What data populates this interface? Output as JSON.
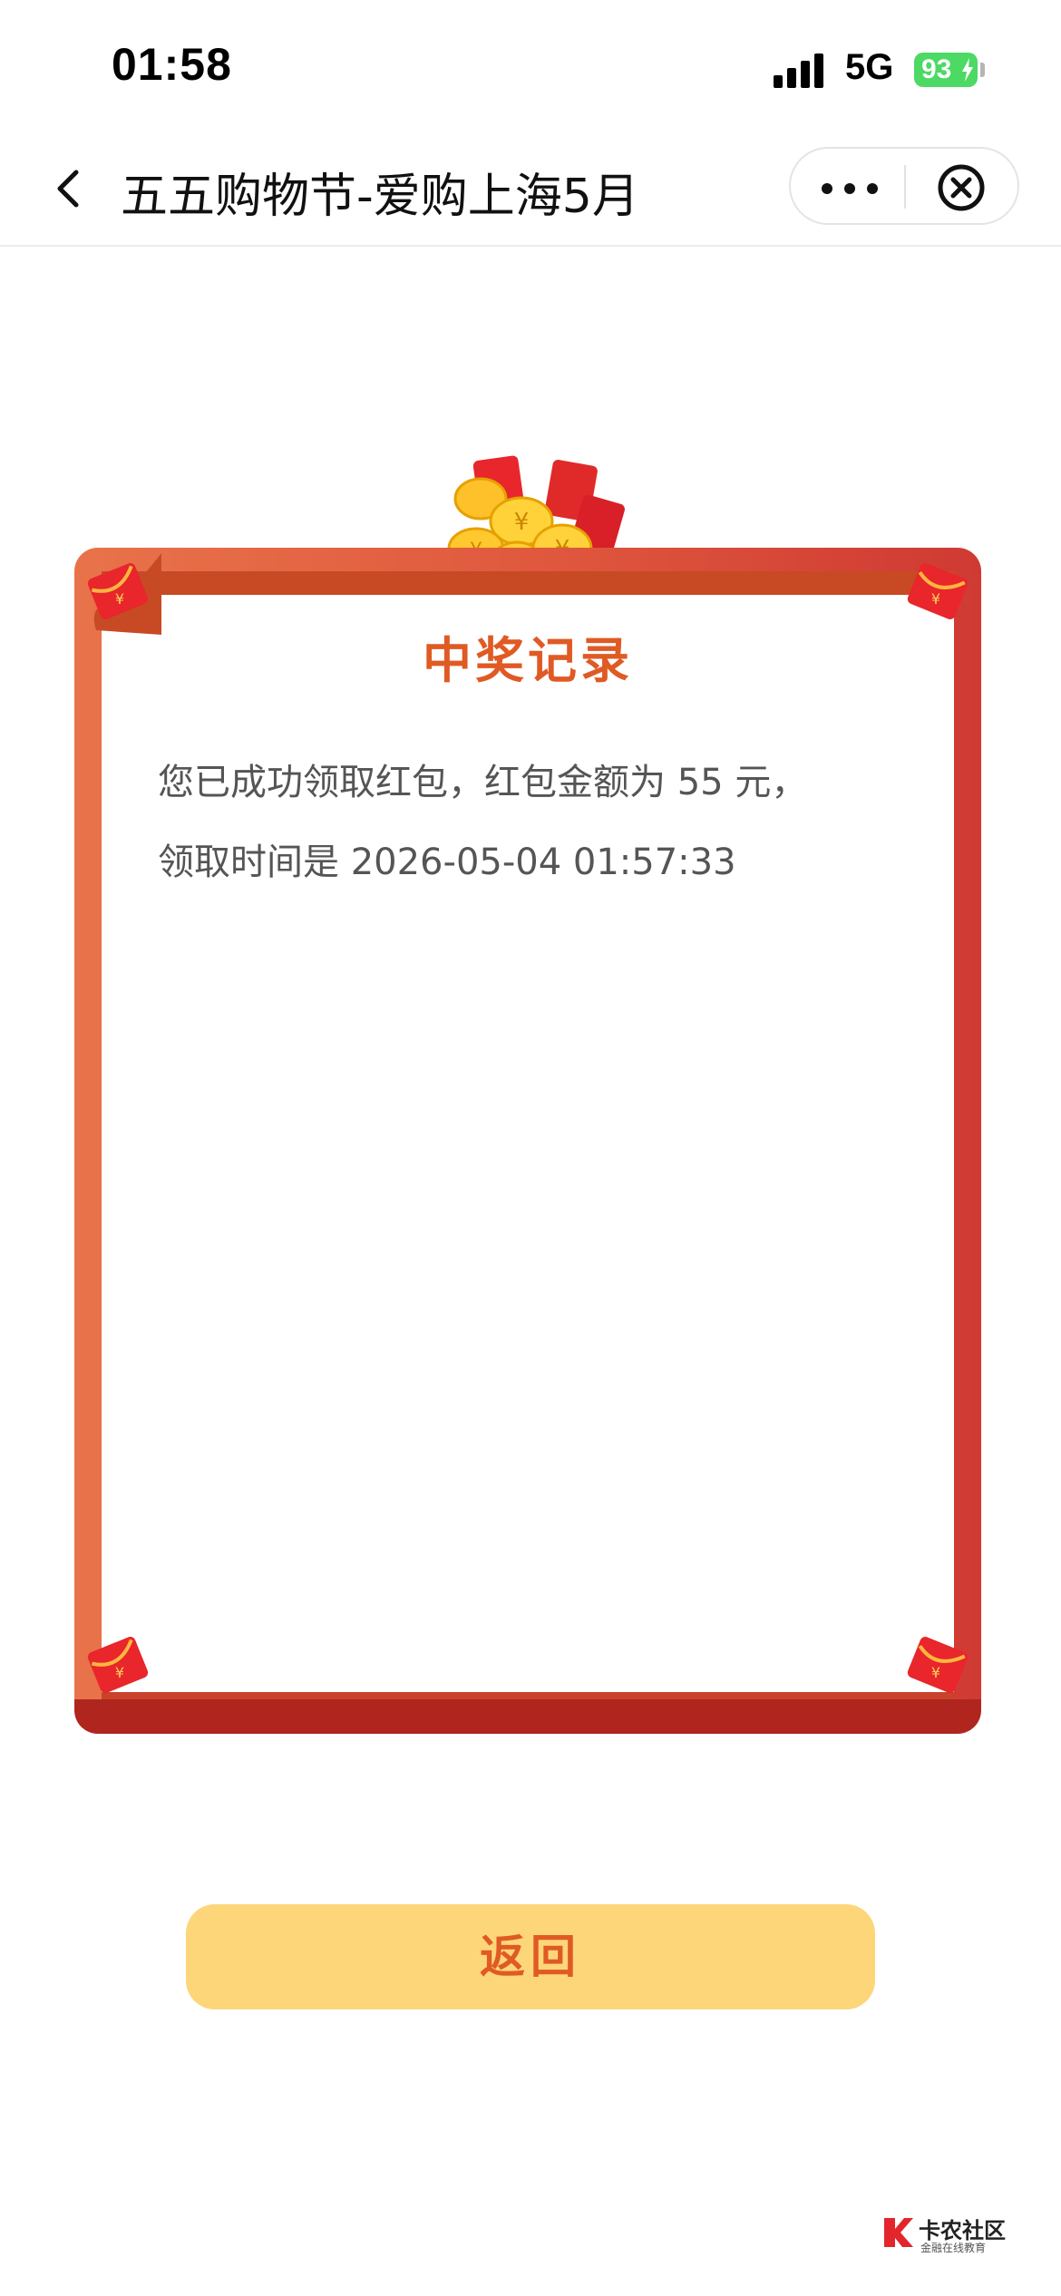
{
  "status_bar": {
    "time": "01:58",
    "network": "5G",
    "battery": "93"
  },
  "nav": {
    "title": "五五购物节-爱购上海5月"
  },
  "card": {
    "title": "中奖记录",
    "message_line1": "您已成功领取红包，红包金额为 55 元，",
    "message_line2": "领取时间是 2026-05-04 01:57:33"
  },
  "button": {
    "back_label": "返回"
  },
  "watermark": {
    "name": "卡农社区",
    "subtitle": "金融在线教育"
  },
  "colors": {
    "frame": "#e0593e",
    "title": "#e05a24",
    "button_bg": "#fdd67a",
    "battery": "#4cd964"
  }
}
